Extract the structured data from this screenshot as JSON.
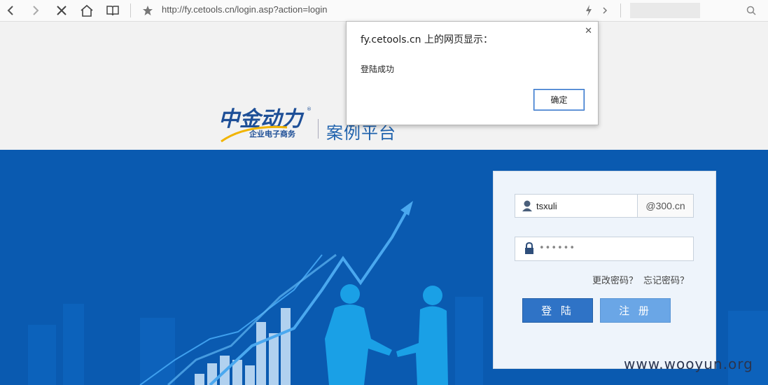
{
  "browser": {
    "url": "http://fy.cetools.cn/login.asp?action=login"
  },
  "brand": {
    "logo_calligraphy": "中金动力",
    "logo_subtitle": "企业电子商务",
    "platform": "案例平台"
  },
  "login": {
    "username": "tsxuli",
    "domain_suffix": "@300.cn",
    "password_mask": "••••••",
    "change_password": "更改密码？",
    "forgot_password": "忘记密码？",
    "login_button": "登 陆",
    "register_button": "注 册"
  },
  "dialog": {
    "title": "fy.cetools.cn 上的网页显示：",
    "message": "登陆成功",
    "ok_button": "确定",
    "close_icon": "close-icon"
  },
  "watermark": "www.wooyun.org",
  "colors": {
    "hero_blue": "#0a5ab0",
    "brand_blue": "#1f62ad",
    "login_button": "#2f73c6",
    "register_button": "#6aa6e6"
  }
}
